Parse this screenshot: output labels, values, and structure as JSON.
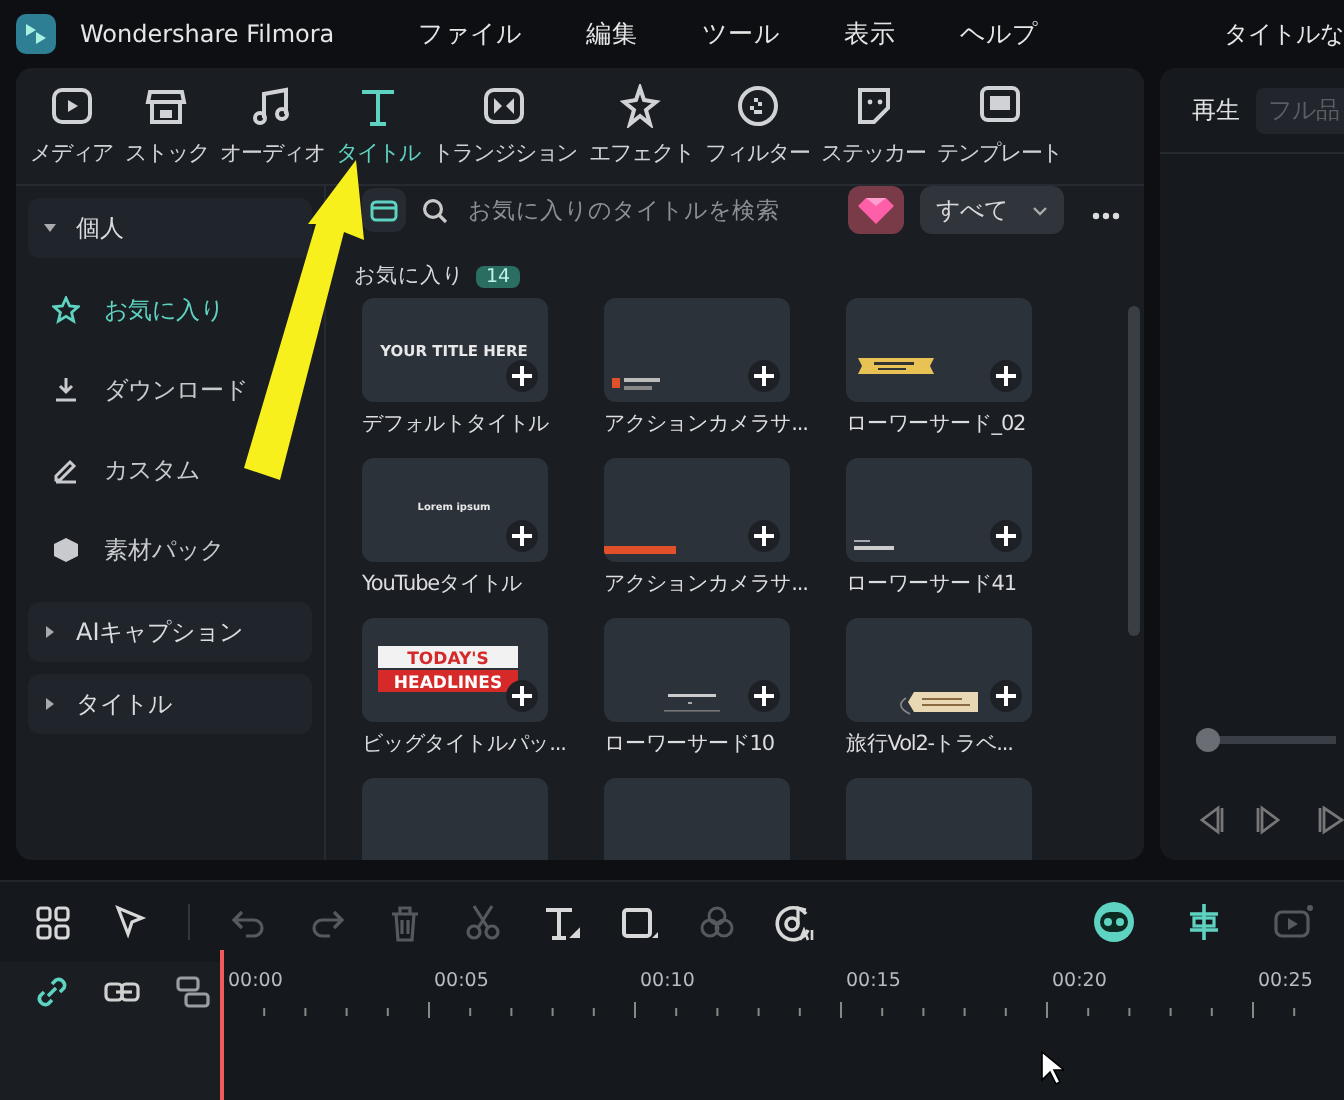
{
  "window": {
    "app_name": "Wondershare Filmora",
    "title": "タイトルな"
  },
  "menu": [
    "ファイル",
    "編集",
    "ツール",
    "表示",
    "ヘルプ"
  ],
  "tabs": [
    {
      "label": "メディア",
      "kind": "media",
      "selected": false
    },
    {
      "label": "ストック",
      "kind": "stock",
      "selected": false
    },
    {
      "label": "オーディオ",
      "kind": "audio",
      "selected": false
    },
    {
      "label": "タイトル",
      "kind": "title",
      "selected": true
    },
    {
      "label": "トランジション",
      "kind": "transition",
      "selected": false
    },
    {
      "label": "エフェクト",
      "kind": "effect",
      "selected": false
    },
    {
      "label": "フィルター",
      "kind": "filter",
      "selected": false
    },
    {
      "label": "ステッカー",
      "kind": "sticker",
      "selected": false
    },
    {
      "label": "テンプレート",
      "kind": "template",
      "selected": false
    }
  ],
  "sidebar": [
    {
      "label": "個人",
      "expanded": true,
      "items": [
        {
          "label": "お気に入り",
          "kind": "star",
          "selected": true
        },
        {
          "label": "ダウンロード",
          "kind": "download",
          "selected": false
        },
        {
          "label": "カスタム",
          "kind": "pen",
          "selected": false
        },
        {
          "label": "素材パック",
          "kind": "pack",
          "selected": false
        }
      ]
    },
    {
      "label": "AIキャプション",
      "expanded": false
    },
    {
      "label": "タイトル",
      "expanded": false
    }
  ],
  "search": {
    "placeholder": "お気に入りのタイトルを検索"
  },
  "filter": {
    "value": "すべて"
  },
  "section": {
    "title": "お気に入り",
    "count": "14"
  },
  "cards": [
    {
      "label": "デフォルトタイトル",
      "kind": "text",
      "thumb_text": [
        "YOUR TITLE HERE"
      ]
    },
    {
      "label": "アクションカメラサ...",
      "kind": "corner"
    },
    {
      "label": "ローワーサード_02",
      "kind": "ribbon"
    },
    {
      "label": "YouTubeタイトル",
      "kind": "text",
      "thumb_text": [
        "Lorem ipsum"
      ]
    },
    {
      "label": "アクションカメラサ...",
      "kind": "orange"
    },
    {
      "label": "ローワーサード41",
      "kind": "lower"
    },
    {
      "label": "ビッグタイトルパッ...",
      "kind": "headline",
      "thumb_text": [
        "TODAY'S",
        "HEADLINES"
      ]
    },
    {
      "label": "ローワーサード10",
      "kind": "center"
    },
    {
      "label": "旅行Vol2-トラベ...",
      "kind": "tag"
    },
    {
      "kind": "blank"
    },
    {
      "kind": "blank"
    },
    {
      "kind": "blank"
    }
  ],
  "preview": {
    "tabs": [
      {
        "label": "再生",
        "selected": true
      },
      {
        "label": "フル品",
        "selected": false
      }
    ],
    "level": 0
  },
  "timeline": {
    "tools": [
      {
        "kind": "grid",
        "disabled": false
      },
      {
        "kind": "pointer",
        "disabled": false
      },
      {
        "kind": "undo",
        "disabled": true
      },
      {
        "kind": "redo",
        "disabled": true
      },
      {
        "kind": "trash",
        "disabled": true
      },
      {
        "kind": "scissors",
        "disabled": true
      },
      {
        "kind": "text",
        "disabled": false
      },
      {
        "kind": "crop",
        "disabled": false
      },
      {
        "kind": "color",
        "disabled": true
      },
      {
        "kind": "ai",
        "disabled": false
      }
    ],
    "right_tools": [
      {
        "kind": "robot",
        "disabled": false
      },
      {
        "kind": "snap",
        "disabled": false
      },
      {
        "kind": "camera",
        "disabled": true
      }
    ],
    "track_tools": [
      {
        "kind": "link",
        "on": true
      },
      {
        "kind": "chain",
        "on": false
      },
      {
        "kind": "split",
        "on": false
      }
    ],
    "ruler": [
      "00:00",
      "00:05",
      "00:10",
      "00:15",
      "00:20",
      "00:25"
    ]
  }
}
